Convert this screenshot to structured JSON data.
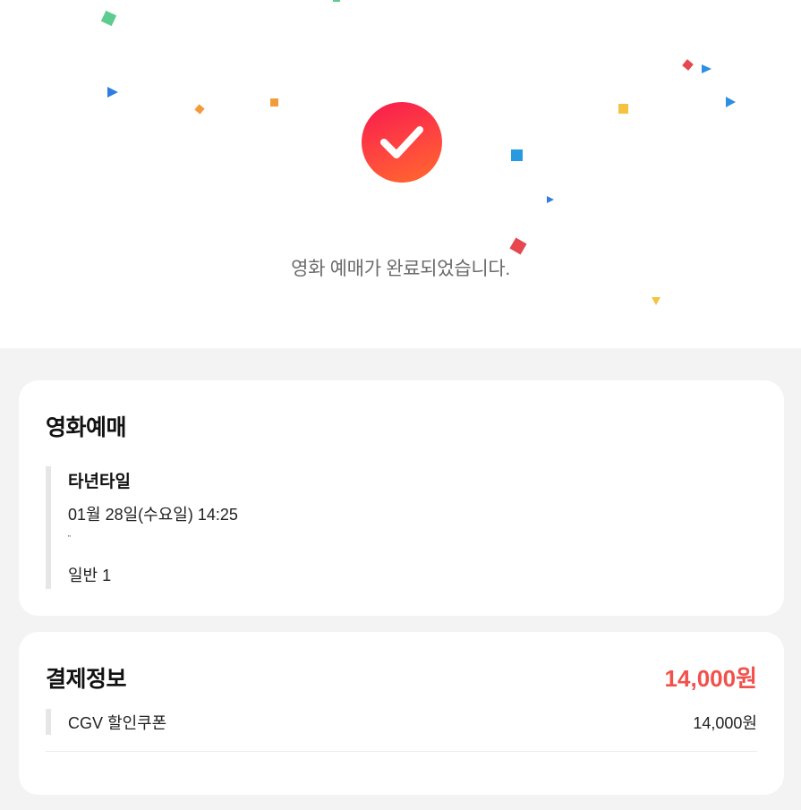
{
  "hero": {
    "message": "영화 예매가 완료되었습니다.",
    "success_icon": "check-icon"
  },
  "booking": {
    "title": "영화예매",
    "movie_title": "타년타일",
    "date_time": "01월 28일(수요일) 14:25",
    "truncated_line": "\"",
    "people": "일반 1"
  },
  "payment": {
    "title": "결제정보",
    "total": "14,000원",
    "items": [
      {
        "label": "CGV 할인쿠폰",
        "amount": "14,000원"
      }
    ]
  },
  "colors": {
    "accent": "#f2514b",
    "check_gradient_start": "#f7194f",
    "check_gradient_end": "#ff6a2b",
    "background": "#f3f3f3"
  }
}
